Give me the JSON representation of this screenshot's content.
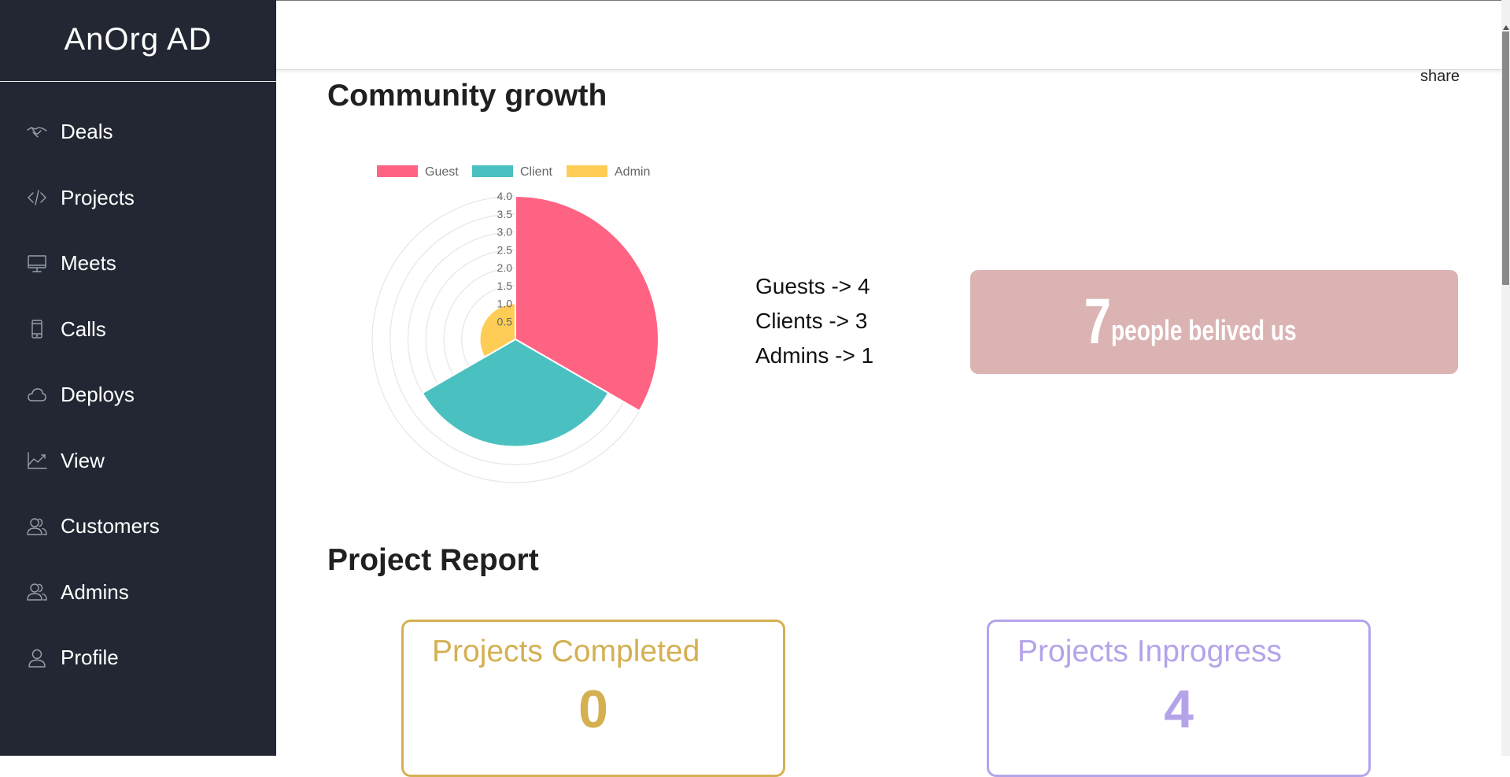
{
  "sidebar": {
    "brand": "AnOrg AD",
    "items": [
      {
        "label": "Deals",
        "icon": "handshake-icon"
      },
      {
        "label": "Projects",
        "icon": "code-icon"
      },
      {
        "label": "Meets",
        "icon": "monitor-icon"
      },
      {
        "label": "Calls",
        "icon": "phone-icon"
      },
      {
        "label": "Deploys",
        "icon": "cloud-icon"
      },
      {
        "label": "View",
        "icon": "chart-line-icon"
      },
      {
        "label": "Customers",
        "icon": "users-icon"
      },
      {
        "label": "Admins",
        "icon": "users-icon"
      },
      {
        "label": "Profile",
        "icon": "user-icon"
      }
    ]
  },
  "header": {
    "share": "share"
  },
  "community": {
    "title": "Community growth",
    "stats": [
      "Guests -> 4",
      "Clients -> 3",
      "Admins -> 1"
    ],
    "believe_count": "7",
    "believe_text": "people belived us"
  },
  "report": {
    "title": "Project Report",
    "completed": {
      "title": "Projects Completed",
      "value": "0"
    },
    "inprogress": {
      "title": "Projects Inprogress",
      "value": "4"
    }
  },
  "colors": {
    "sidebar_bg": "#222733",
    "guest": "#ff6384",
    "client": "#4bc0c0",
    "admin": "#ffcd56",
    "completed": "#d4b052",
    "inprogress": "#b5a3ea",
    "believe_bg": "#dcb3b3"
  },
  "chart_data": {
    "type": "polarArea",
    "categories": [
      "Guest",
      "Client",
      "Admin"
    ],
    "values": [
      4,
      3,
      1
    ],
    "colors": [
      "#ff6384",
      "#4bc0c0",
      "#ffcd56"
    ],
    "ticks": [
      "4.0",
      "3.5",
      "3.0",
      "2.5",
      "2.0",
      "1.5",
      "1.0",
      "0.5"
    ],
    "rlim": [
      0,
      4
    ],
    "legend": "top"
  }
}
